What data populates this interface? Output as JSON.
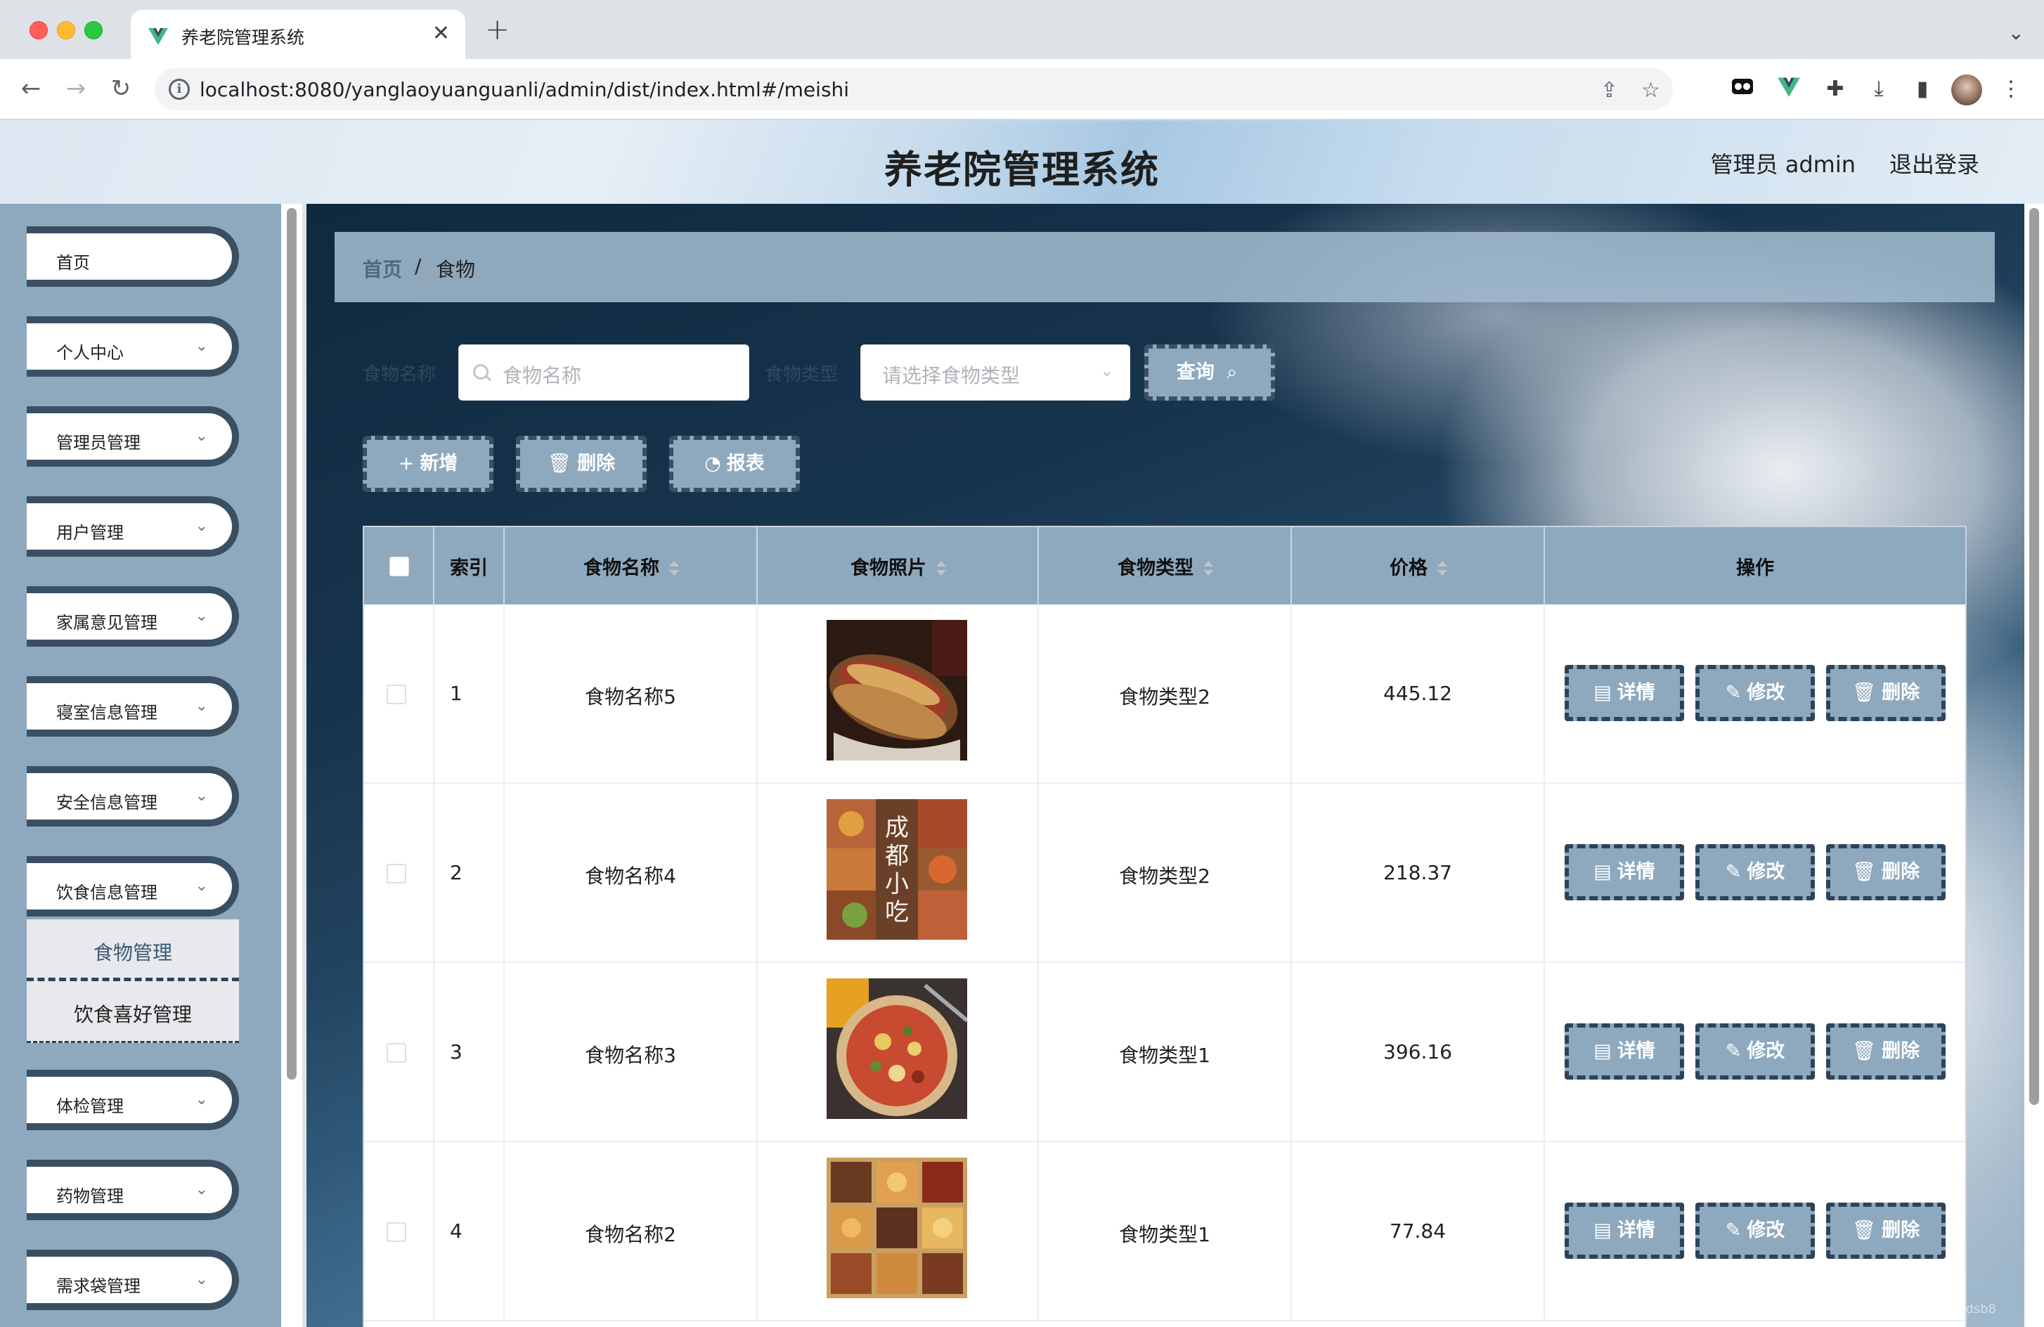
{
  "browser": {
    "tab_title": "养老院管理系统",
    "tab_close": "✕",
    "new_tab": "+",
    "url": "localhost:8080/yanglaoyuanguanli/admin/dist/index.html#/meishi"
  },
  "header": {
    "title": "养老院管理系统",
    "admin_label": "管理员 admin",
    "logout_label": "退出登录"
  },
  "sidebar": {
    "items": [
      {
        "label": "首页"
      },
      {
        "label": "个人中心"
      },
      {
        "label": "管理员管理"
      },
      {
        "label": "用户管理"
      },
      {
        "label": "家属意见管理"
      },
      {
        "label": "寝室信息管理"
      },
      {
        "label": "安全信息管理"
      },
      {
        "label": "饮食信息管理"
      },
      {
        "label": "体检管理"
      },
      {
        "label": "药物管理"
      },
      {
        "label": "需求袋管理"
      }
    ],
    "submenu": [
      {
        "label": "食物管理"
      },
      {
        "label": "饮食喜好管理"
      }
    ]
  },
  "breadcrumb": {
    "home": "首页",
    "sep": "/",
    "current": "食物"
  },
  "filters": {
    "name_label": "食物名称",
    "name_placeholder": "食物名称",
    "type_label": "食物类型",
    "type_placeholder": "请选择食物类型",
    "query_label": "查询"
  },
  "actions": {
    "add": "新增",
    "delete": "删除",
    "report": "报表"
  },
  "table": {
    "headers": {
      "index": "索引",
      "name": "食物名称",
      "photo": "食物照片",
      "type": "食物类型",
      "price": "价格",
      "ops": "操作"
    },
    "rows": [
      {
        "index": "1",
        "name": "食物名称5",
        "type": "食物类型2",
        "price": "445.12"
      },
      {
        "index": "2",
        "name": "食物名称4",
        "type": "食物类型2",
        "price": "218.37"
      },
      {
        "index": "3",
        "name": "食物名称3",
        "type": "食物类型1",
        "price": "396.16"
      },
      {
        "index": "4",
        "name": "食物名称2",
        "type": "食物类型1",
        "price": "77.84"
      }
    ],
    "op_labels": {
      "detail": "详情",
      "edit": "修改",
      "delete": "删除"
    }
  },
  "watermark": "CSDN @小蒙dsb8"
}
